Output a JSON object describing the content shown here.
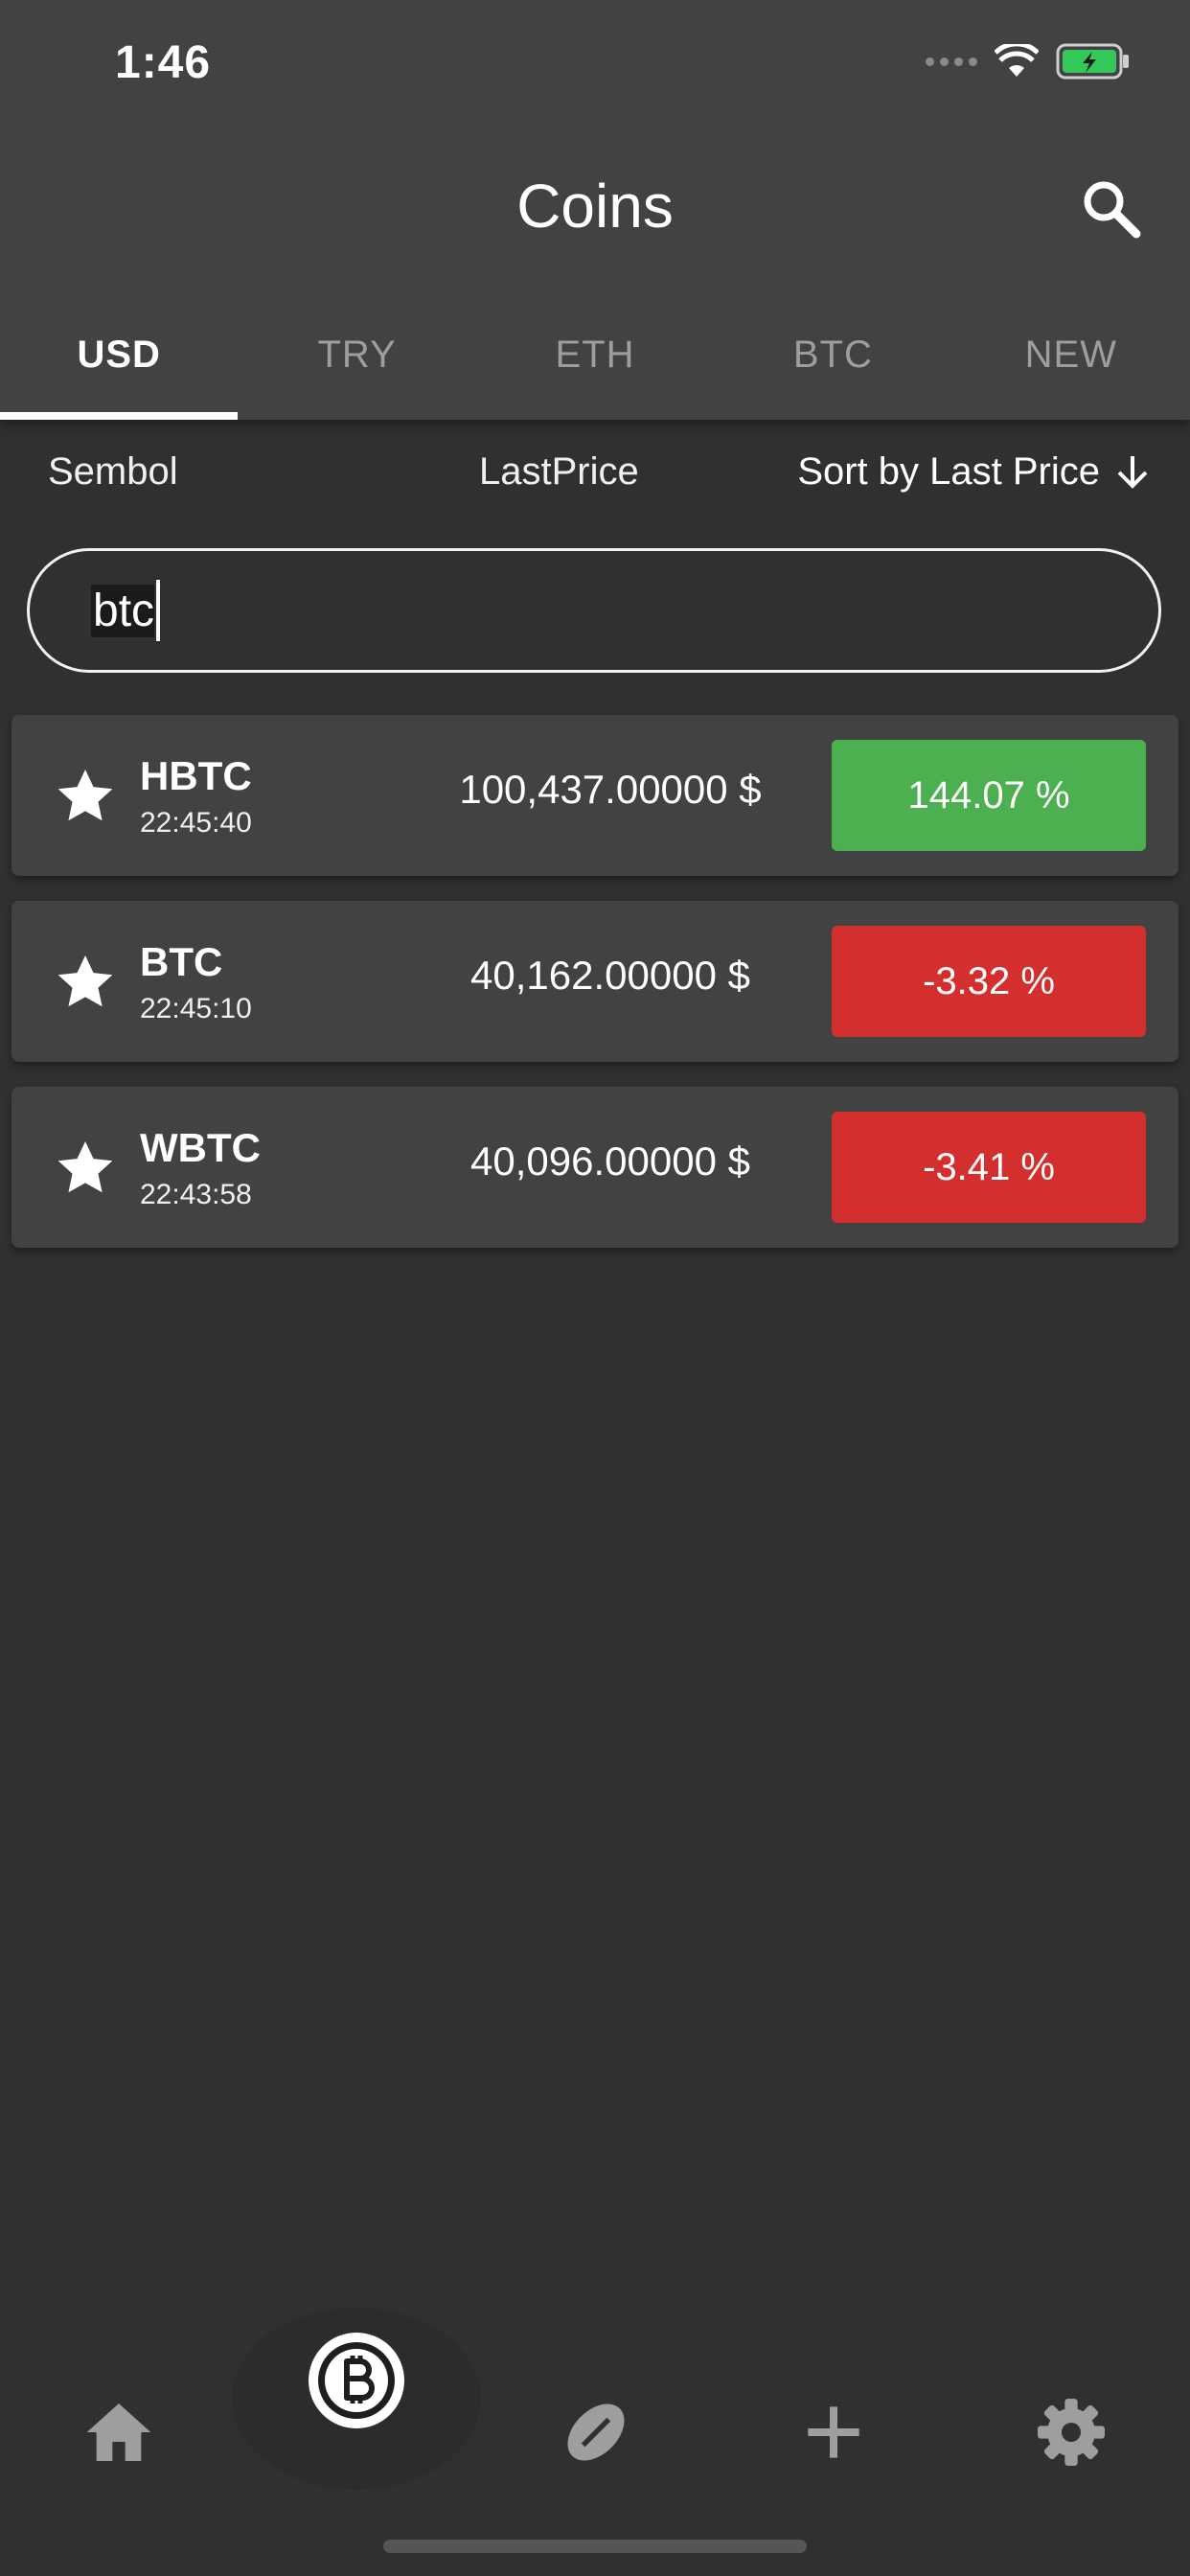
{
  "status": {
    "time": "1:46"
  },
  "header": {
    "title": "Coins"
  },
  "tabs": [
    {
      "label": "USD",
      "active": true
    },
    {
      "label": "TRY",
      "active": false
    },
    {
      "label": "ETH",
      "active": false
    },
    {
      "label": "BTC",
      "active": false
    },
    {
      "label": "NEW",
      "active": false
    }
  ],
  "columns": {
    "symbol": "Sembol",
    "last_price": "LastPrice",
    "sort": "Sort by Last Price"
  },
  "search": {
    "value": "btc"
  },
  "coins": [
    {
      "symbol": "HBTC",
      "time": "22:45:40",
      "price": "100,437.00000 $",
      "change": "144.07 %",
      "color": "#4caf50"
    },
    {
      "symbol": "BTC",
      "time": "22:45:10",
      "price": "40,162.00000 $",
      "change": "-3.32 %",
      "color": "#d32f2f"
    },
    {
      "symbol": "WBTC",
      "time": "22:43:58",
      "price": "40,096.00000 $",
      "change": "-3.41 %",
      "color": "#d32f2f"
    }
  ],
  "nav": [
    "home-icon",
    "bitcoin-icon",
    "football-icon",
    "plus-icon",
    "gear-icon"
  ],
  "colors": {
    "background": "#303030",
    "surface": "#424242",
    "positive": "#4caf50",
    "negative": "#d32f2f"
  }
}
